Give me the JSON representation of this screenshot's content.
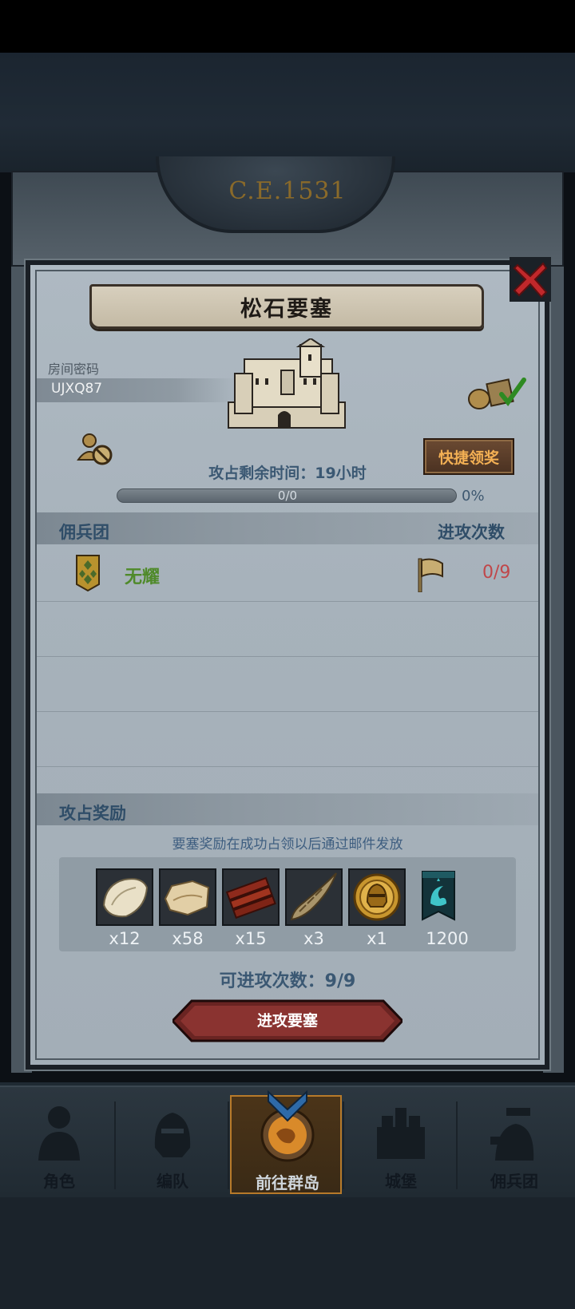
{
  "header": {
    "era": "C.E.1531"
  },
  "panel": {
    "title": "松石要塞",
    "room_label": "房间密码",
    "room_code": "UJXQ87",
    "quick_claim_label": "快捷领奖",
    "time_label": "攻占剩余时间：19小时",
    "progress": {
      "text": "0/0",
      "percent_text": "0%",
      "fraction": 0.0
    }
  },
  "mercenary": {
    "header_left": "佣兵团",
    "header_right": "进攻次数",
    "rows": [
      {
        "name": "无耀",
        "attacks": "0/9"
      }
    ]
  },
  "rewards": {
    "title": "攻占奖励",
    "note": "要塞奖励在成功占领以后通过邮件发放",
    "items": [
      {
        "icon": "fur-pelt-icon",
        "qty": "x12"
      },
      {
        "icon": "hide-icon",
        "qty": "x58"
      },
      {
        "icon": "wood-planks-icon",
        "qty": "x15"
      },
      {
        "icon": "horn-icon",
        "qty": "x3"
      },
      {
        "icon": "knight-helmet-coin-icon",
        "qty": "x1"
      },
      {
        "icon": "banner-token-icon",
        "qty": "1200"
      }
    ]
  },
  "attack": {
    "remaining_label": "可进攻次数：9/9",
    "button_label": "进攻要塞"
  },
  "nav": {
    "items": [
      {
        "label": "角色",
        "icon": "character-icon"
      },
      {
        "label": "编队",
        "icon": "formation-icon"
      },
      {
        "label": "前往群岛",
        "icon": "islands-icon"
      },
      {
        "label": "城堡",
        "icon": "castle-icon"
      },
      {
        "label": "佣兵团",
        "icon": "mercenary-icon"
      }
    ],
    "active_index": 2
  },
  "colors": {
    "accent_red": "#c0474a",
    "guild_green": "#4f8a2a",
    "quick_orange": "#f3b054"
  }
}
